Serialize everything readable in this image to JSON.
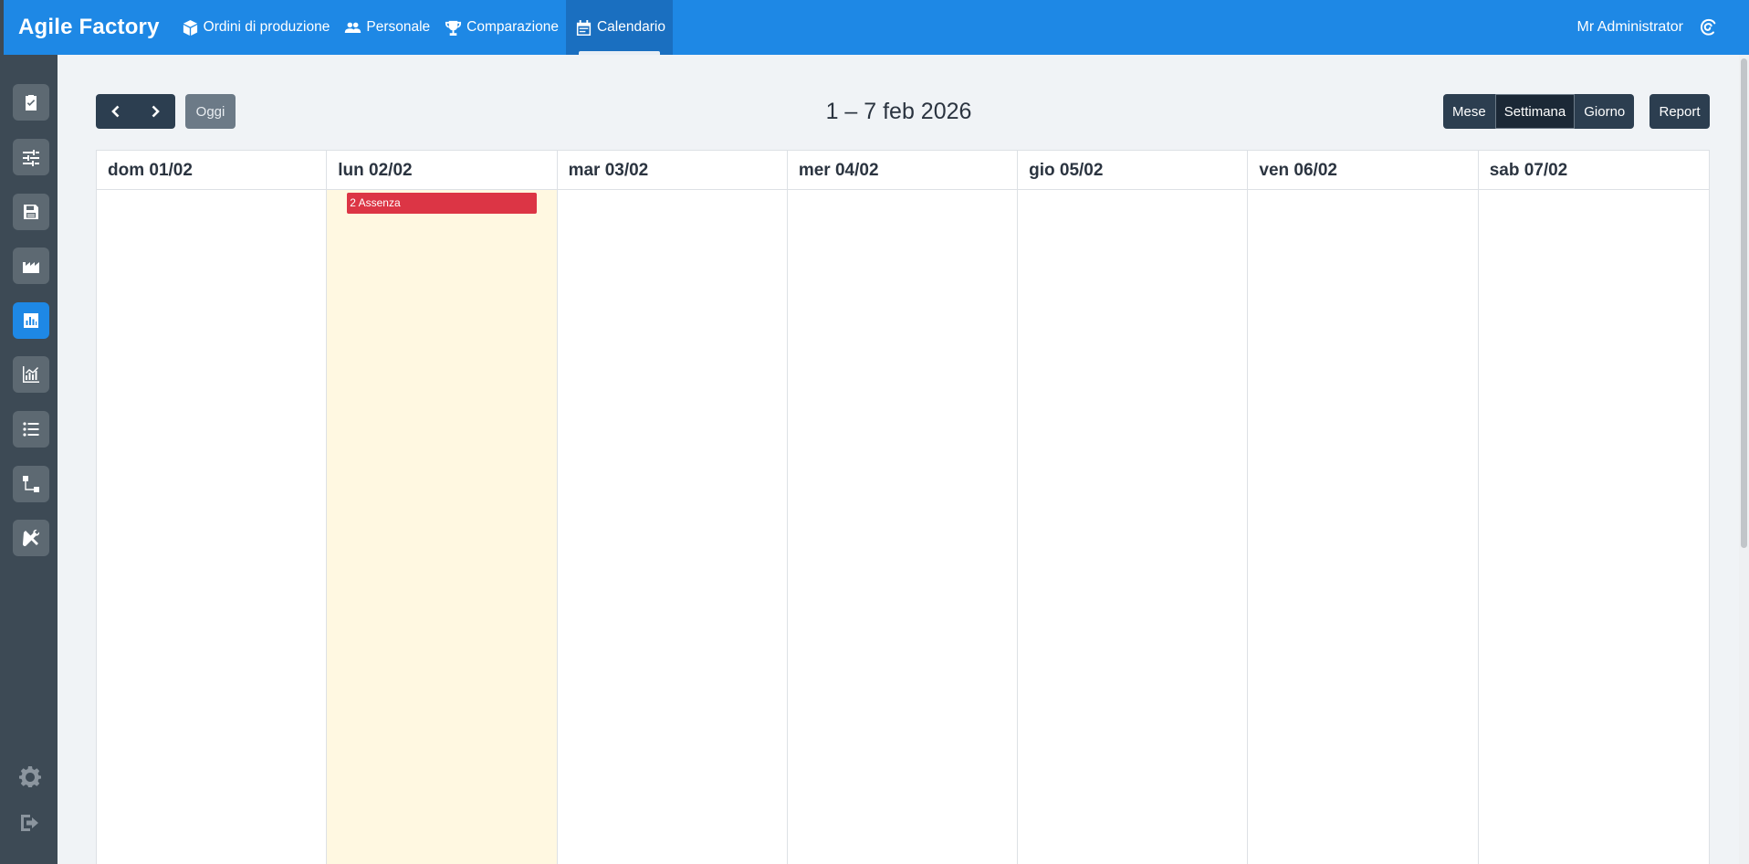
{
  "app": {
    "title": "Agile Factory"
  },
  "nav": {
    "items": [
      {
        "label": "Ordini di produzione",
        "icon": "box-icon"
      },
      {
        "label": "Personale",
        "icon": "users-icon"
      },
      {
        "label": "Comparazione",
        "icon": "trophy-icon"
      },
      {
        "label": "Calendario",
        "icon": "calendar-icon",
        "active": true
      }
    ]
  },
  "user": {
    "name": "Mr Administrator",
    "icon": "brand-swirl-icon"
  },
  "sidebar": {
    "items": [
      {
        "icon": "clipboard-check-icon"
      },
      {
        "icon": "sliders-icon"
      },
      {
        "icon": "save-icon"
      },
      {
        "icon": "factory-icon"
      },
      {
        "icon": "bar-chart-icon",
        "active": true
      },
      {
        "icon": "line-chart-icon"
      },
      {
        "icon": "list-icon"
      },
      {
        "icon": "flow-icon"
      },
      {
        "icon": "tools-icon"
      }
    ],
    "bottom": [
      {
        "icon": "gear-icon"
      },
      {
        "icon": "logout-icon"
      }
    ]
  },
  "toolbar": {
    "prev_icon": "chevron-left-icon",
    "next_icon": "chevron-right-icon",
    "today_label": "Oggi",
    "range_title": "1 – 7 feb 2026",
    "views": [
      "Mese",
      "Settimana",
      "Giorno"
    ],
    "active_view": "Settimana",
    "report_label": "Report"
  },
  "calendar": {
    "days": [
      "dom 01/02",
      "lun 02/02",
      "mar 03/02",
      "mer 04/02",
      "gio 05/02",
      "ven 06/02",
      "sab 07/02"
    ],
    "today_index": 1,
    "events": [
      {
        "day_index": 1,
        "label": "2 Assenza",
        "color": "#dc3545"
      }
    ]
  },
  "colors": {
    "primary": "#1e88e5",
    "dark": "#2c3e50",
    "rail": "#3d4a55",
    "today": "#fff8e1",
    "event": "#dc3545"
  }
}
